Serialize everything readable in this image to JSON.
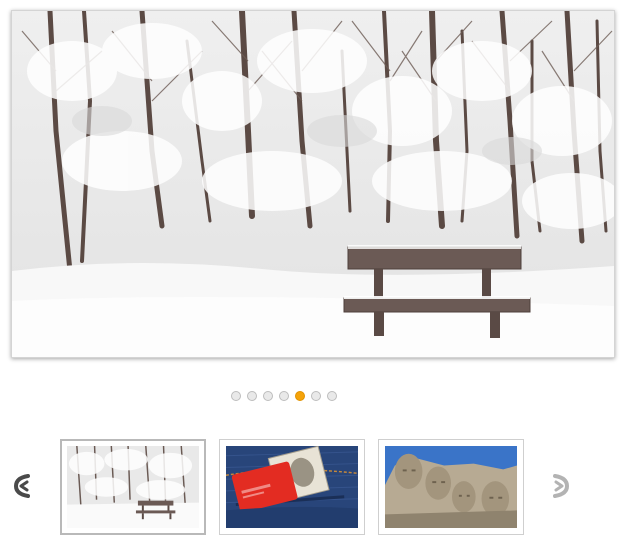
{
  "slider": {
    "main_image": "snowy-forest-bench",
    "dots_count": 7,
    "active_dot": 5
  },
  "thumbnails": [
    {
      "image": "snowy-forest-bench",
      "active": true
    },
    {
      "image": "credit-card-in-jeans-pocket",
      "active": false
    },
    {
      "image": "mount-rushmore",
      "active": false
    }
  ],
  "nav": {
    "prev_icon": "chevron-left-icon",
    "next_icon": "chevron-right-icon"
  },
  "colors": {
    "active_dot": "#f5a30a",
    "inactive_dot": "#e9e9e9"
  }
}
